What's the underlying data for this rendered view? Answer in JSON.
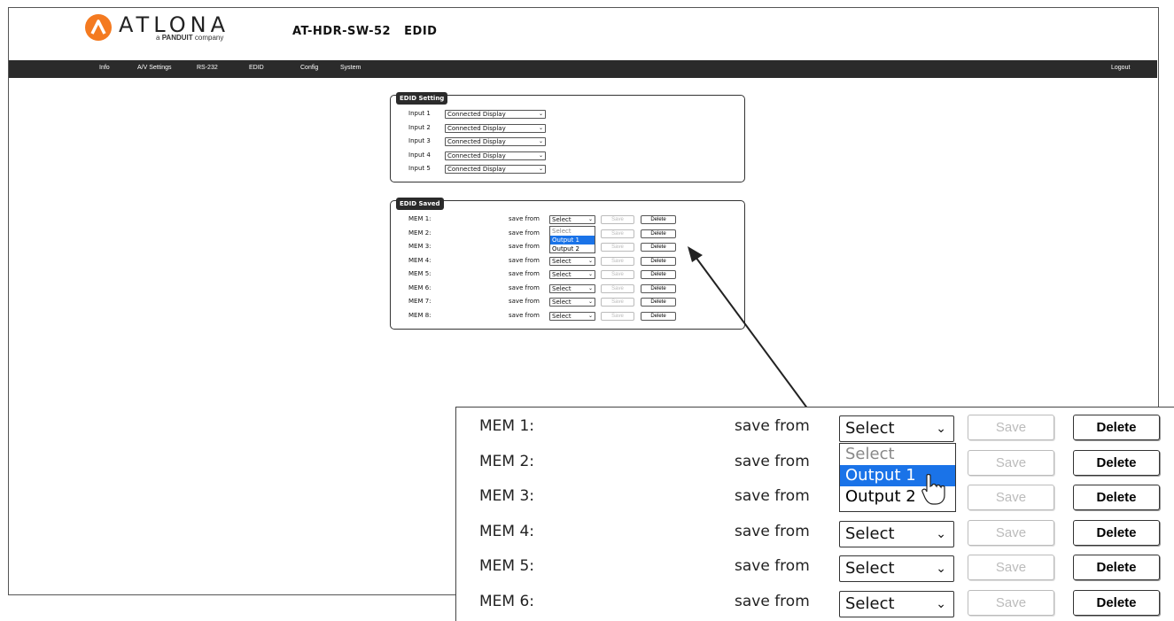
{
  "header": {
    "logo_text": "ATLONA",
    "logo_sub_prefix": "a",
    "logo_sub_brand": "PANDUIT",
    "logo_sub_suffix": "company",
    "page_title": "AT-HDR-SW-52   EDID"
  },
  "nav": {
    "items": [
      "Info",
      "A/V Settings",
      "RS-232",
      "EDID",
      "Config",
      "System"
    ],
    "logout": "Logout"
  },
  "edid_setting": {
    "title": "EDID Setting",
    "rows": [
      {
        "label": "Input 1",
        "value": "Connected Display"
      },
      {
        "label": "Input 2",
        "value": "Connected Display"
      },
      {
        "label": "Input 3",
        "value": "Connected Display"
      },
      {
        "label": "Input 4",
        "value": "Connected Display"
      },
      {
        "label": "Input 5",
        "value": "Connected Display"
      }
    ]
  },
  "edid_saved": {
    "title": "EDID Saved",
    "save_from_label": "save from",
    "save_label": "Save",
    "delete_label": "Delete",
    "select_value": "Select",
    "rows": [
      "MEM 1:",
      "MEM 2:",
      "MEM 3:",
      "MEM 4:",
      "MEM 5:",
      "MEM 6:",
      "MEM 7:",
      "MEM 8:"
    ],
    "dropdown_options": [
      "Select",
      "Output 1",
      "Output 2"
    ],
    "highlighted_option": "Output 1"
  },
  "zoom_rows": [
    "MEM 1:",
    "MEM 2:",
    "MEM 3:",
    "MEM 4:",
    "MEM 5:",
    "MEM 6:"
  ],
  "colors": {
    "nav_bg": "#2b2b2b",
    "accent_orange": "#f47a20",
    "highlight_blue": "#1a73e8"
  }
}
